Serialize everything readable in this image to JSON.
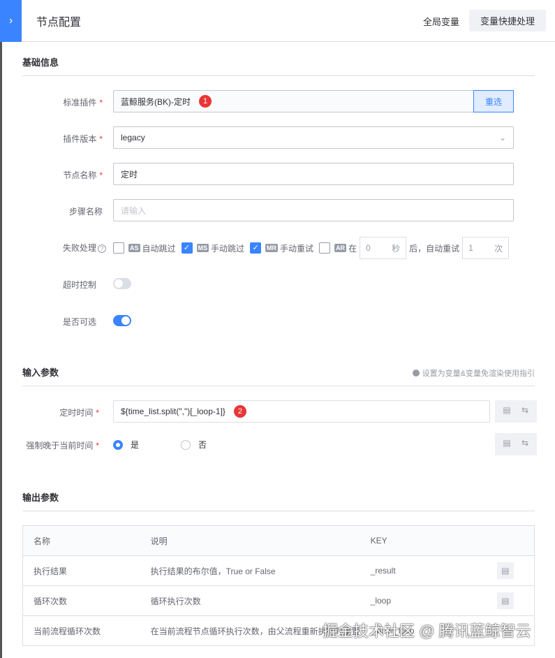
{
  "header": {
    "title": "节点配置",
    "global_vars": "全局变量",
    "quick_var": "变量快捷处理",
    "toggle_icon": "›"
  },
  "basic": {
    "title": "基础信息",
    "plugin": {
      "label": "标准插件",
      "value": "蓝鲸服务(BK)-定时",
      "badge": "1",
      "reselect": "重选"
    },
    "version": {
      "label": "插件版本",
      "value": "legacy"
    },
    "node_name": {
      "label": "节点名称",
      "value": "定时"
    },
    "step_name": {
      "label": "步骤名称",
      "placeholder": "请输入"
    },
    "failure": {
      "label": "失败处理",
      "options": [
        {
          "tag": "AS",
          "label": "自动跳过",
          "checked": false
        },
        {
          "tag": "MS",
          "label": "手动跳过",
          "checked": true
        },
        {
          "tag": "MR",
          "label": "手动重试",
          "checked": true
        },
        {
          "tag": "AR",
          "label": "在",
          "checked": false
        }
      ],
      "seconds_value": "0",
      "seconds_unit": "秒",
      "after_text": "后，自动重试",
      "times_value": "1",
      "times_unit": "次"
    },
    "timeout": {
      "label": "超时控制",
      "on": false
    },
    "optional": {
      "label": "是否可选",
      "on": true
    }
  },
  "input": {
    "title": "输入参数",
    "hint": "设置为变量&变量免渲染使用指引",
    "timing": {
      "label": "定时时间",
      "value": "${time_list.split(\",\")[_loop-1]}",
      "badge": "2"
    },
    "force_late": {
      "label": "强制晚于当前时间",
      "options": [
        "是",
        "否"
      ],
      "selected": "是"
    }
  },
  "output": {
    "title": "输出参数",
    "columns": [
      "名称",
      "说明",
      "KEY"
    ],
    "rows": [
      {
        "name": "执行结果",
        "desc": "执行结果的布尔值，True or False",
        "key": "_result"
      },
      {
        "name": "循环次数",
        "desc": "循环执行次数",
        "key": "_loop"
      },
      {
        "name": "当前流程循环次数",
        "desc": "在当前流程节点循环执行次数，由父流程重新执行时重置",
        "key": "_inner_loop"
      }
    ]
  },
  "watermark": "掘金技术社区 @ 腾讯蓝鲸智云",
  "colors": {
    "primary": "#3a84ff",
    "danger": "#ea3636"
  }
}
